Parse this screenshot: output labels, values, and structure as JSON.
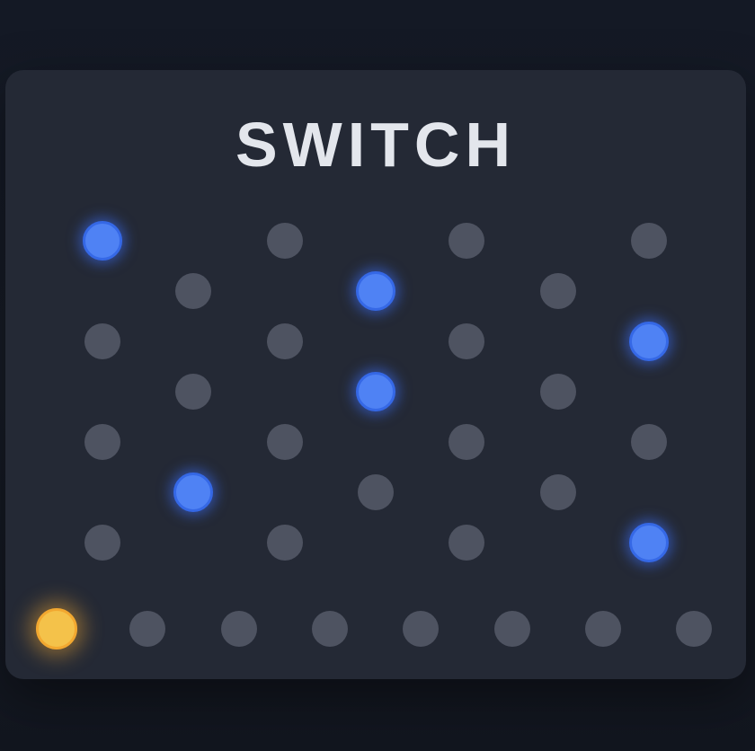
{
  "title": "SWITCH",
  "colors": {
    "background": "#151a24",
    "board": "#242935",
    "dot_off": "#4e5361",
    "dot_on": "#4f82f4",
    "player": "#f4c24a",
    "title": "#e3e6ec"
  },
  "grid": {
    "rows": [
      [
        "on",
        "off",
        "off",
        "off"
      ],
      [
        "off",
        "on",
        "off"
      ],
      [
        "off",
        "off",
        "off",
        "on"
      ],
      [
        "off",
        "on",
        "off"
      ],
      [
        "off",
        "off",
        "off",
        "off"
      ],
      [
        "on",
        "off",
        "off"
      ],
      [
        "off",
        "off",
        "off",
        "on"
      ]
    ]
  },
  "track": {
    "count": 8,
    "player_index": 0
  }
}
